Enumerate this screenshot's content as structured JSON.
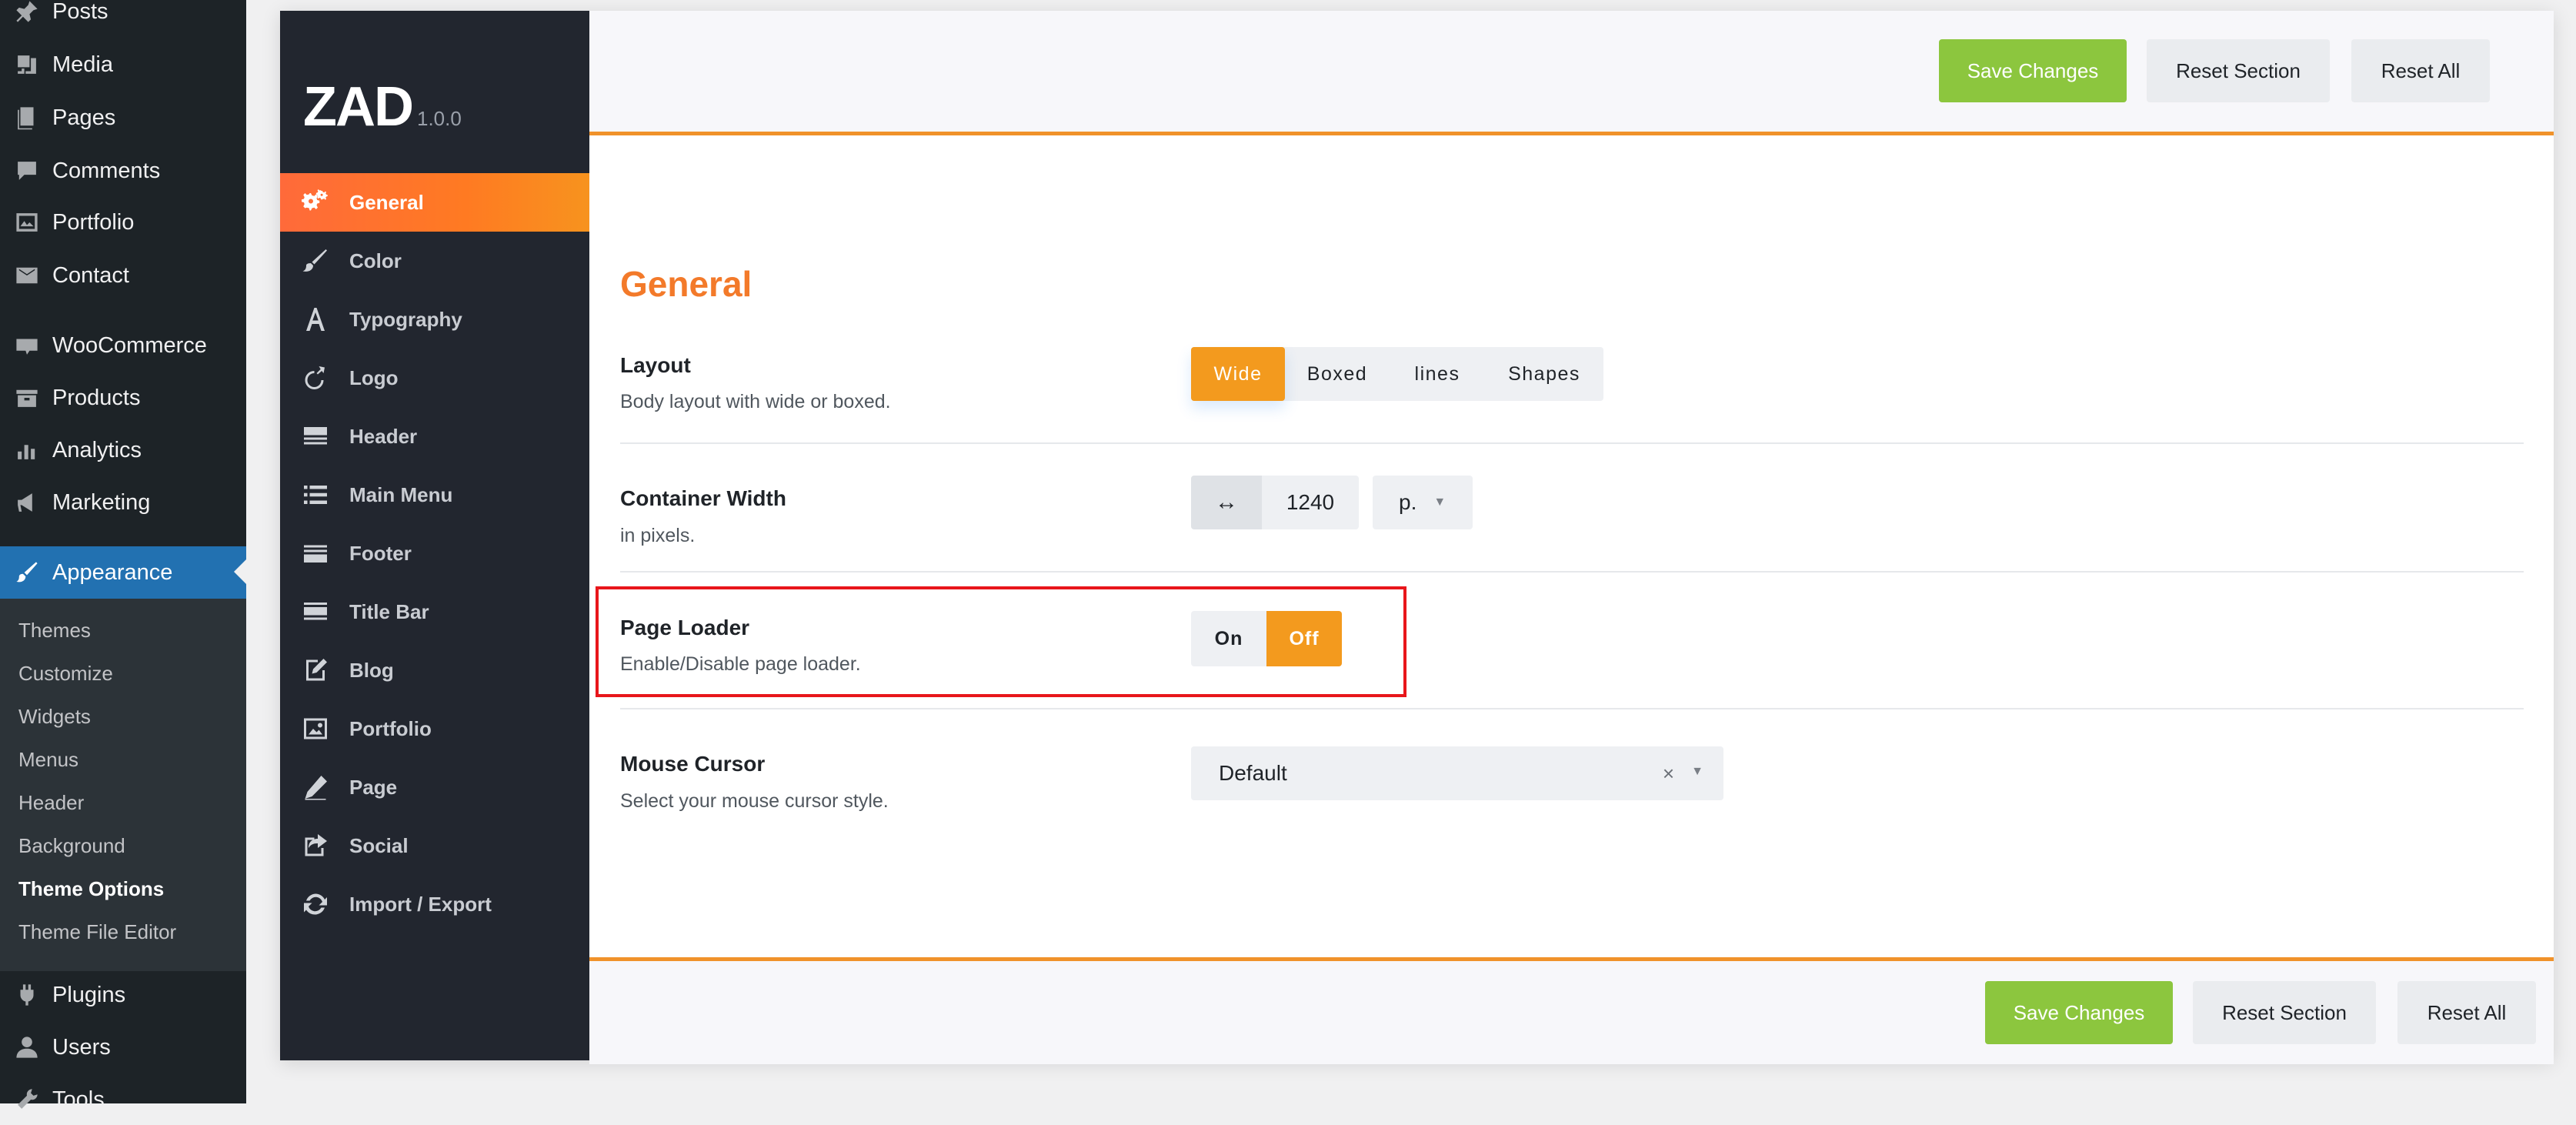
{
  "wp_sidebar": {
    "items": [
      {
        "label": "Posts",
        "icon": "pin-icon"
      },
      {
        "label": "Media",
        "icon": "media-icon"
      },
      {
        "label": "Pages",
        "icon": "pages-icon"
      },
      {
        "label": "Comments",
        "icon": "comments-icon"
      },
      {
        "label": "Portfolio",
        "icon": "portfolio-icon"
      },
      {
        "label": "Contact",
        "icon": "mail-icon"
      },
      {
        "label": "WooCommerce",
        "icon": "woo-icon"
      },
      {
        "label": "Products",
        "icon": "products-icon"
      },
      {
        "label": "Analytics",
        "icon": "analytics-icon"
      },
      {
        "label": "Marketing",
        "icon": "megaphone-icon"
      },
      {
        "label": "Appearance",
        "icon": "brush-icon"
      },
      {
        "label": "Plugins",
        "icon": "plugin-icon"
      },
      {
        "label": "Users",
        "icon": "users-icon"
      },
      {
        "label": "Tools",
        "icon": "tools-icon"
      }
    ],
    "submenu": [
      "Themes",
      "Customize",
      "Widgets",
      "Menus",
      "Header",
      "Background",
      "Theme Options",
      "Theme File Editor"
    ]
  },
  "panel": {
    "brand": "ZAD",
    "version": "1.0.0",
    "nav": [
      {
        "label": "General",
        "icon": "gears-icon"
      },
      {
        "label": "Color",
        "icon": "brush-icon"
      },
      {
        "label": "Typography",
        "icon": "font-icon"
      },
      {
        "label": "Logo",
        "icon": "logo-icon"
      },
      {
        "label": "Header",
        "icon": "header-icon"
      },
      {
        "label": "Main Menu",
        "icon": "list-icon"
      },
      {
        "label": "Footer",
        "icon": "footer-icon"
      },
      {
        "label": "Title Bar",
        "icon": "titlebar-icon"
      },
      {
        "label": "Blog",
        "icon": "edit-icon"
      },
      {
        "label": "Portfolio",
        "icon": "image-icon"
      },
      {
        "label": "Page",
        "icon": "pencil-icon"
      },
      {
        "label": "Social",
        "icon": "share-icon"
      },
      {
        "label": "Import / Export",
        "icon": "refresh-icon"
      }
    ]
  },
  "actions": {
    "save": "Save Changes",
    "reset_section": "Reset Section",
    "reset_all": "Reset All"
  },
  "section": {
    "title": "General",
    "layout": {
      "title": "Layout",
      "desc": "Body layout with wide or boxed.",
      "options": [
        "Wide",
        "Boxed",
        "lines",
        "Shapes"
      ],
      "selected": "Wide"
    },
    "container_width": {
      "title": "Container Width",
      "desc": "in pixels.",
      "addon": "↔",
      "value": "1240",
      "unit": "p."
    },
    "page_loader": {
      "title": "Page Loader",
      "desc": "Enable/Disable page loader.",
      "on": "On",
      "off": "Off",
      "selected": "Off"
    },
    "mouse_cursor": {
      "title": "Mouse Cursor",
      "desc": "Select your mouse cursor style.",
      "value": "Default",
      "clear": "×",
      "caret": "▼"
    }
  },
  "colors": {
    "accent": "#f39a1e",
    "save": "#8cc63e",
    "wp_active": "#2271b1",
    "highlight": "#e8161b"
  }
}
